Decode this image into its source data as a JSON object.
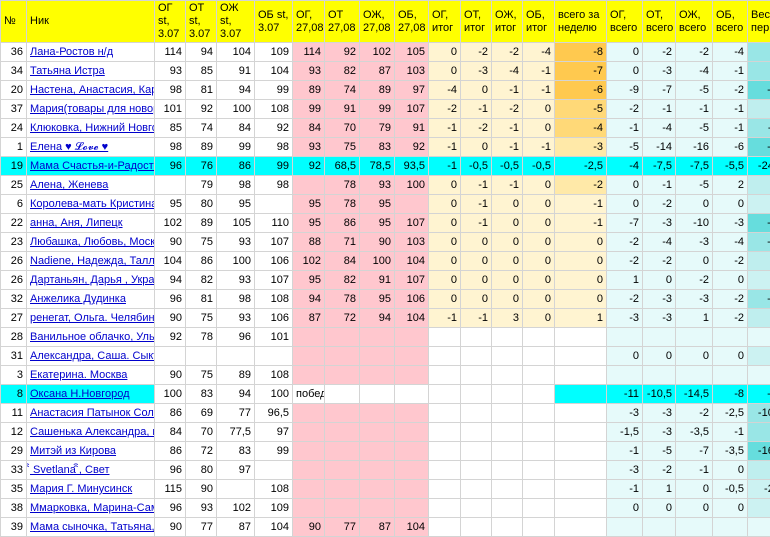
{
  "headers": [
    "№",
    "Ник",
    "ОГ st, 3.07",
    "ОТ st, 3.07",
    "ОЖ st, 3.07",
    "ОБ st, 3.07",
    "ОГ, 27,08",
    "ОТ 27,08",
    "ОЖ, 27,08",
    "ОБ, 27,08",
    "ОГ, итог",
    "ОТ, итог",
    "ОЖ, итог",
    "ОБ, итог",
    "всего за неделю",
    "ОГ, всего",
    "ОТ, всего",
    "ОЖ, всего",
    "ОБ, всего",
    "Весь период"
  ],
  "rows": [
    {
      "n": "36",
      "nick": "Лана-Ростов н/д",
      "c": [
        "114",
        "94",
        "104",
        "109",
        "114",
        "92",
        "102",
        "105",
        "0",
        "-2",
        "-2",
        "-4",
        "-8",
        "0",
        "-2",
        "-2",
        "-4",
        "-8"
      ]
    },
    {
      "n": "34",
      "nick": "Татьяна Истра",
      "c": [
        "93",
        "85",
        "91",
        "104",
        "93",
        "82",
        "87",
        "103",
        "0",
        "-3",
        "-4",
        "-1",
        "-7",
        "0",
        "-3",
        "-4",
        "-1",
        "-8"
      ]
    },
    {
      "n": "20",
      "nick": "Настена, Анастасия, Карл",
      "c": [
        "98",
        "81",
        "94",
        "99",
        "89",
        "74",
        "89",
        "97",
        "-4",
        "0",
        "-1",
        "-1",
        "-6",
        "-9",
        "-7",
        "-5",
        "-2",
        "-23"
      ]
    },
    {
      "n": "37",
      "nick": "Мария(товары для новор",
      "c": [
        "101",
        "92",
        "100",
        "108",
        "99",
        "91",
        "99",
        "107",
        "-2",
        "-1",
        "-2",
        "0",
        "-5",
        "-2",
        "-1",
        "-1",
        "-1",
        "-5"
      ]
    },
    {
      "n": "24",
      "nick": "Клюковка, Нижний Новго",
      "c": [
        "85",
        "74",
        "84",
        "92",
        "84",
        "70",
        "79",
        "91",
        "-1",
        "-2",
        "-1",
        "0",
        "-4",
        "-1",
        "-4",
        "-5",
        "-1",
        "-11"
      ]
    },
    {
      "n": "1",
      "nick": "Елена ♥ 𝓛𝓸𝓿𝓮 ♥",
      "c": [
        "98",
        "89",
        "99",
        "98",
        "93",
        "75",
        "83",
        "92",
        "-1",
        "0",
        "-1",
        "-1",
        "-3",
        "-5",
        "-14",
        "-16",
        "-6",
        "-41"
      ]
    },
    {
      "n": "19",
      "nick": "Мама Счастья-и-Радости",
      "hl": true,
      "c": [
        "96",
        "76",
        "86",
        "99",
        "92",
        "68,5",
        "78,5",
        "93,5",
        "-1",
        "-0,5",
        "-0,5",
        "-0,5",
        "-2,5",
        "-4",
        "-7,5",
        "-7,5",
        "-5,5",
        "-24,5"
      ]
    },
    {
      "n": "25",
      "nick": "Алена, Женева",
      "c": [
        "",
        "79",
        "98",
        "98",
        "",
        "78",
        "93",
        "100",
        "0",
        "-1",
        "-1",
        "0",
        "-2",
        "0",
        "-1",
        "-5",
        "2",
        "-4"
      ]
    },
    {
      "n": "6",
      "nick": "Королева-мать Кристина",
      "c": [
        "95",
        "80",
        "95",
        "",
        "95",
        "78",
        "95",
        "",
        "0",
        "-1",
        "0",
        "0",
        "-1",
        "0",
        "-2",
        "0",
        "0",
        "-2"
      ]
    },
    {
      "n": "22",
      "nick": "анна, Аня, Липецк",
      "c": [
        "102",
        "89",
        "105",
        "110",
        "95",
        "86",
        "95",
        "107",
        "0",
        "-1",
        "0",
        "0",
        "-1",
        "-7",
        "-3",
        "-10",
        "-3",
        "-23"
      ]
    },
    {
      "n": "23",
      "nick": "Любашка, Любовь, Моск",
      "c": [
        "90",
        "75",
        "93",
        "107",
        "88",
        "71",
        "90",
        "103",
        "0",
        "0",
        "0",
        "0",
        "0",
        "-2",
        "-4",
        "-3",
        "-4",
        "-13"
      ]
    },
    {
      "n": "26",
      "nick": "Nadiene, Надежда, Талли",
      "c": [
        "104",
        "86",
        "100",
        "106",
        "102",
        "84",
        "100",
        "104",
        "0",
        "0",
        "0",
        "0",
        "0",
        "-2",
        "-2",
        "0",
        "-2",
        "-6"
      ]
    },
    {
      "n": "26",
      "nick": "Дартаньян, Дарья , Украи",
      "c": [
        "94",
        "82",
        "93",
        "107",
        "95",
        "82",
        "91",
        "107",
        "0",
        "0",
        "0",
        "0",
        "0",
        "1",
        "0",
        "-2",
        "0",
        "-1"
      ]
    },
    {
      "n": "32",
      "nick": "Анжелика Дудинка",
      "c": [
        "96",
        "81",
        "98",
        "108",
        "94",
        "78",
        "95",
        "106",
        "0",
        "0",
        "0",
        "0",
        "0",
        "-2",
        "-3",
        "-3",
        "-2",
        "-10"
      ]
    },
    {
      "n": "27",
      "nick": "ренегат, Ольга. Челябинс",
      "c": [
        "90",
        "75",
        "93",
        "106",
        "87",
        "72",
        "94",
        "104",
        "-1",
        "-1",
        "3",
        "0",
        "1",
        "-3",
        "-3",
        "1",
        "-2",
        "-7"
      ]
    },
    {
      "n": "28",
      "nick": "Ванильное облачко, Ульт",
      "c": [
        "92",
        "78",
        "96",
        "101",
        "",
        "",
        "",
        "",
        "",
        "",
        "",
        "",
        "",
        "",
        "",
        "",
        "",
        ""
      ]
    },
    {
      "n": "31",
      "nick": "Александра, Саша. Сыктывкар",
      "c": [
        "",
        "",
        "",
        "",
        "",
        "",
        "",
        "",
        "",
        "",
        "",
        "",
        "",
        "0",
        "0",
        "0",
        "0",
        "0"
      ]
    },
    {
      "n": "3",
      "nick": "Екатерина. Москва",
      "c": [
        "90",
        "75",
        "89",
        "108",
        "",
        "",
        "",
        "",
        "",
        "",
        "",
        "",
        "",
        "",
        "",
        "",
        "",
        ""
      ]
    },
    {
      "n": "8",
      "nick": "Оксана Н.Новгород",
      "win": true,
      "c": [
        "100",
        "83",
        "94",
        "100",
        "победа",
        "",
        "",
        "",
        "",
        "",
        "",
        "",
        "",
        "-11",
        "-10,5",
        "-14,5",
        "-8",
        "-44"
      ]
    },
    {
      "n": "11",
      "nick": "Анастасия Патынок Солн",
      "c": [
        "86",
        "69",
        "77",
        "96,5",
        "",
        "",
        "",
        "",
        "",
        "",
        "",
        "",
        "",
        "-3",
        "-3",
        "-2",
        "-2,5",
        "-10,5"
      ]
    },
    {
      "n": "12",
      "nick": "Сашенька Александра, г.",
      "c": [
        "84",
        "70",
        "77,5",
        "97",
        "",
        "",
        "",
        "",
        "",
        "",
        "",
        "",
        "",
        "-1,5",
        "-3",
        "-3,5",
        "-1",
        "-9"
      ]
    },
    {
      "n": "29",
      "nick": "Митэй из Кирова",
      "c": [
        "86",
        "72",
        "83",
        "99",
        "",
        "",
        "",
        "",
        "",
        "",
        "",
        "",
        "",
        "-1",
        "-5",
        "-7",
        "-3,5",
        "-16,5"
      ]
    },
    {
      "n": "33",
      "nick": "ꩰꩰ Svetlana ꩰꩰ, Свет",
      "c": [
        "96",
        "80",
        "97",
        "",
        "",
        "",
        "",
        "",
        "",
        "",
        "",
        "",
        "",
        "-3",
        "-2",
        "-1",
        "0",
        "-6"
      ]
    },
    {
      "n": "35",
      "nick": "Мария Г. Минусинск",
      "c": [
        "115",
        "90",
        "",
        "108",
        "",
        "",
        "",
        "",
        "",
        "",
        "",
        "",
        "",
        "-1",
        "1",
        "0",
        "-0,5",
        "-2,5"
      ]
    },
    {
      "n": "38",
      "nick": "Ммарковка, Марина-Сам",
      "c": [
        "96",
        "93",
        "102",
        "109",
        "",
        "",
        "",
        "",
        "",
        "",
        "",
        "",
        "",
        "0",
        "0",
        "0",
        "0",
        "0"
      ]
    },
    {
      "n": "39",
      "nick": "Мама сыночка, Татьяна, !",
      "c": [
        "90",
        "77",
        "87",
        "104",
        "90",
        "77",
        "87",
        "104",
        "",
        "",
        "",
        "",
        "",
        "",
        "",
        "",
        "",
        ""
      ]
    }
  ]
}
